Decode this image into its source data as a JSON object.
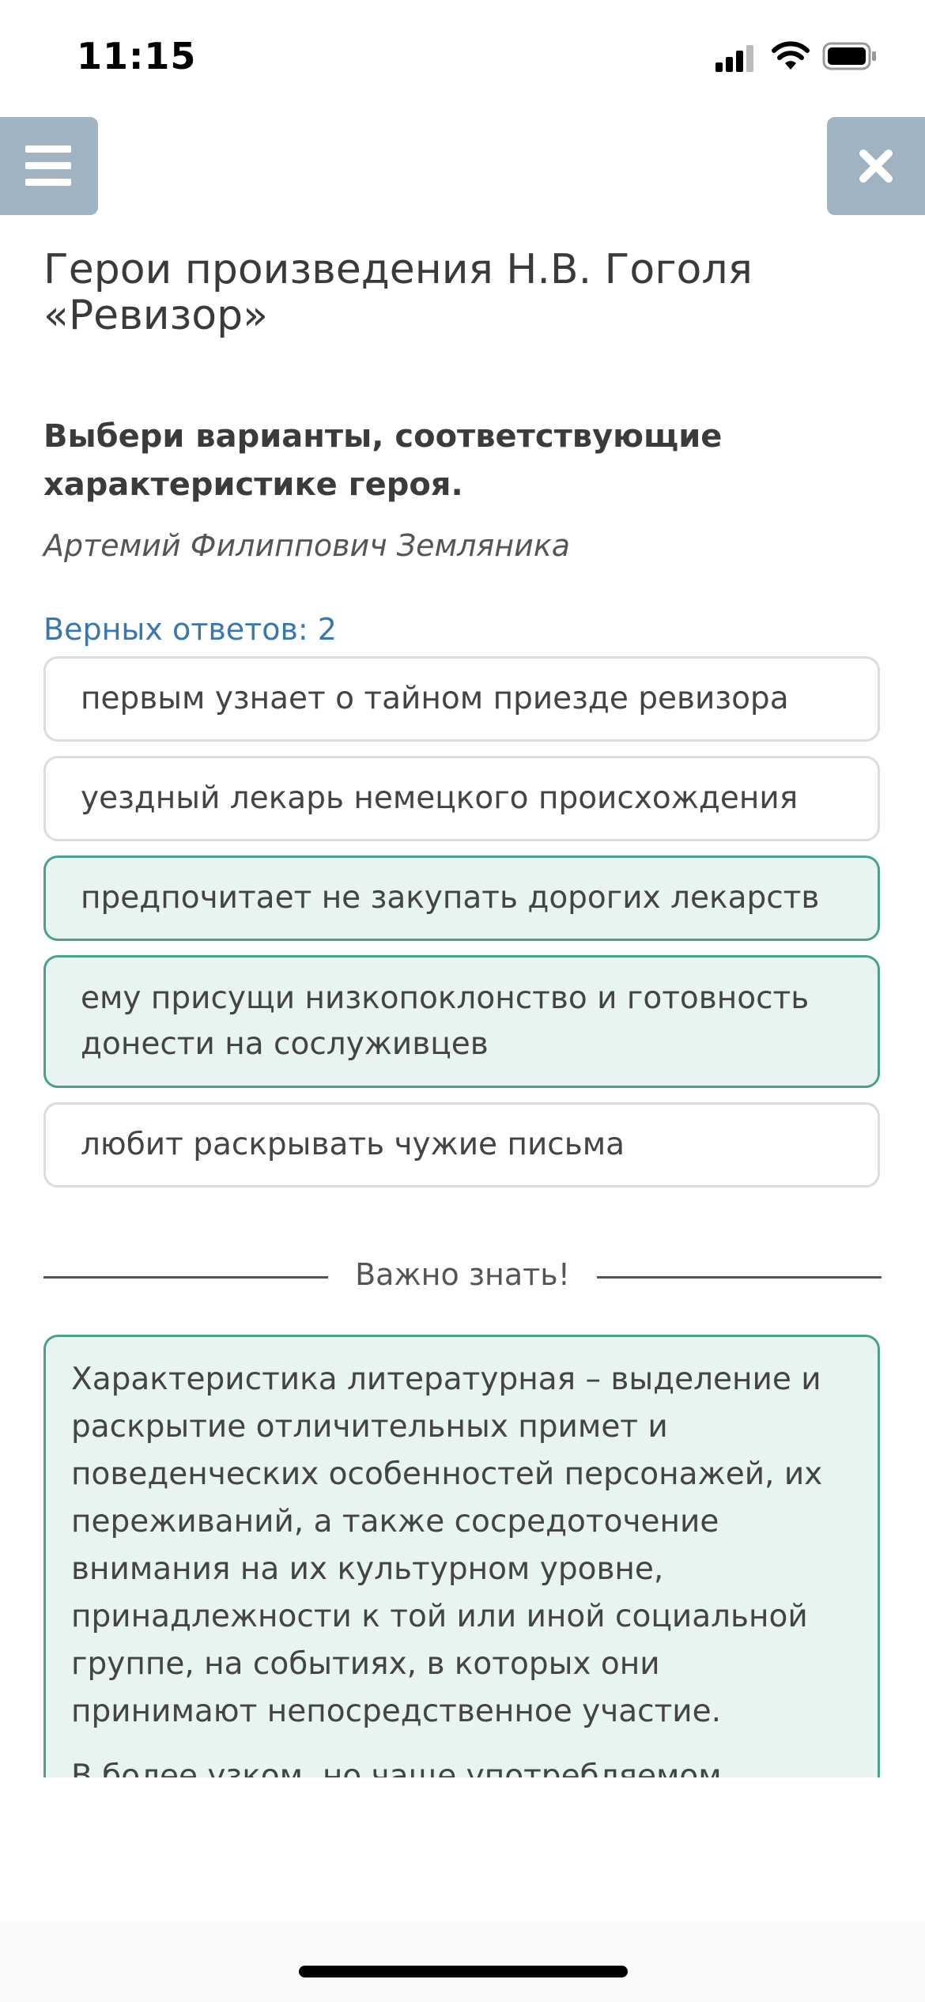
{
  "status_bar": {
    "time": "11:15",
    "icons": [
      "signal-icon",
      "wifi-icon",
      "battery-icon"
    ]
  },
  "header": {
    "menu_icon": "hamburger-menu-icon",
    "close_icon": "close-x-icon"
  },
  "title": "Герои произведения Н.В. Гоголя «Ревизор»",
  "instruction": "Выбери варианты, соответствующие характеристике героя.",
  "hero_name": "Артемий Филиппович Земляника",
  "correct_count_label": "Верных ответов: 2",
  "options": [
    {
      "text": "первым узнает о тайном приезде ревизора",
      "selected": false
    },
    {
      "text": "уездный лекарь немецкого происхождения",
      "selected": false
    },
    {
      "text": "предпочитает не закупать дорогих лекарств",
      "selected": true
    },
    {
      "text": "ему присущи низкопоклонство и готовность донести на сослуживцев",
      "selected": true
    },
    {
      "text": "любит раскрывать чужие письма",
      "selected": false
    }
  ],
  "divider_label": "Важно знать!",
  "info": {
    "paragraph_1": "Характеристика литературная – выделение и раскрытие отличительных примет и поведенческих особенностей персонажей, их переживаний, а также сосредоточение внимания на их культурном уровне, принадлежности к той или иной социальной группе, на событиях, в которых они принимают непосредственное участие.",
    "paragraph_2": "В более узком, но чаще употребляемом значении характеристикой называют оценочные сведения о герое, которые могут сообщаться им самим (автохарактеристика)"
  },
  "colors": {
    "button_bg": "#9fb3c2",
    "accent_blue": "#3a77b0",
    "selected_bg": "#e8f4f1",
    "selected_border": "#4aa08c",
    "option_border": "#dcdcdc"
  }
}
